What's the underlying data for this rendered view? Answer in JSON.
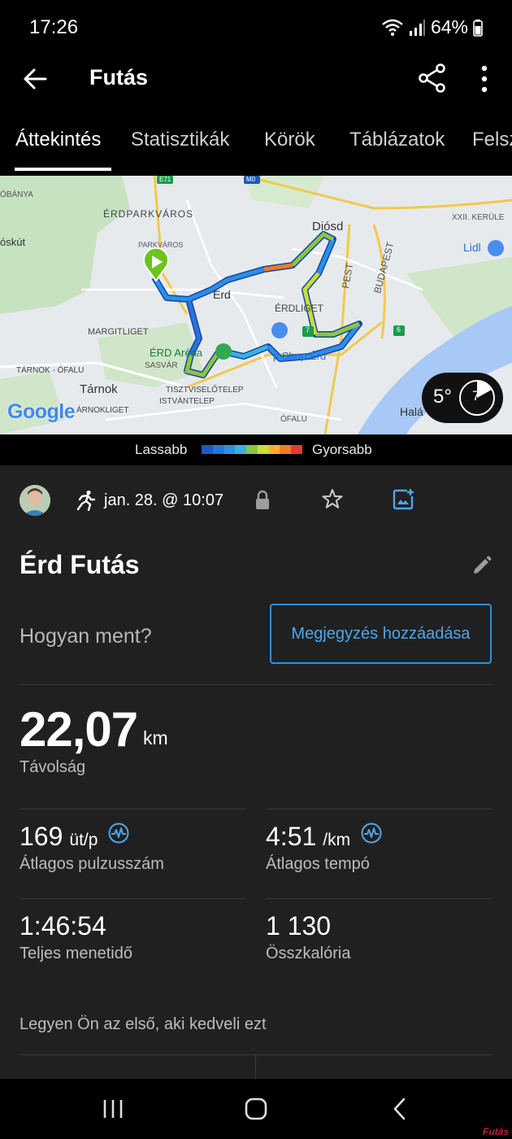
{
  "status": {
    "time": "17:26",
    "battery": "64%"
  },
  "appbar": {
    "title": "Futás"
  },
  "tabs": [
    "Áttekintés",
    "Statisztikák",
    "Körök",
    "Táblázatok",
    "Felsz"
  ],
  "map": {
    "labels": {
      "obanya": "ÓBÁNYA",
      "erdparkvaros": "ÉRDPARKVÁROS",
      "oskut": "óskút",
      "parkvaros": "PARKVÁROS",
      "diosd": "Diósd",
      "xxii": "XXII. KERÜLE",
      "lidl": "Lidl",
      "erd": "Érd",
      "erdliget": "ÉRDLIGET",
      "pest": "PEST",
      "budapest": "BUDAPEST",
      "margitliget": "MARGITLIGET",
      "erdarena": "ÉRD Aréna",
      "sasvar": "SASVÁR",
      "shop": "p Shop Érd",
      "tarnokofalu": "TÁRNOK - ÓFALU",
      "tarnok": "Tárnok",
      "tisztviselotelep": "TISZTVISELŐTELEP",
      "istvantelep": "ISTVÁNTELEP",
      "arnokliget": "ÁRNOKLIGET",
      "ofalu": "ÓFALU",
      "halasz": "Halá",
      "e71": "E71",
      "m0": "M0",
      "r6": "6",
      "r7": "7",
      "google": "Google"
    },
    "weather": {
      "temp": "5°",
      "wind": "7"
    }
  },
  "legend": {
    "slower": "Lassabb",
    "faster": "Gyorsabb",
    "colors": [
      "#1e57c9",
      "#2576d8",
      "#2b90e6",
      "#37b3e0",
      "#8cc63f",
      "#cddc39",
      "#f5b12e",
      "#f47c20",
      "#e53935"
    ]
  },
  "activity": {
    "date": "jan. 28. @ 10:07",
    "title": "Érd Futás",
    "how_prompt": "Hogyan ment?",
    "note_button": "Megjegyzés hozzáadása",
    "distance": {
      "value": "22,07",
      "unit": "km",
      "label": "Távolság"
    },
    "heart_rate": {
      "value": "169",
      "unit": "üt/p",
      "label": "Átlagos pulzusszám"
    },
    "pace": {
      "value": "4:51",
      "unit": "/km",
      "label": "Átlagos tempó"
    },
    "time": {
      "value": "1:46:54",
      "label": "Teljes menetidő"
    },
    "calories": {
      "value": "1 130",
      "label": "Összkalória"
    },
    "likes": "Legyen Ön az első, aki kedveli ezt"
  },
  "watermark": "Futás"
}
